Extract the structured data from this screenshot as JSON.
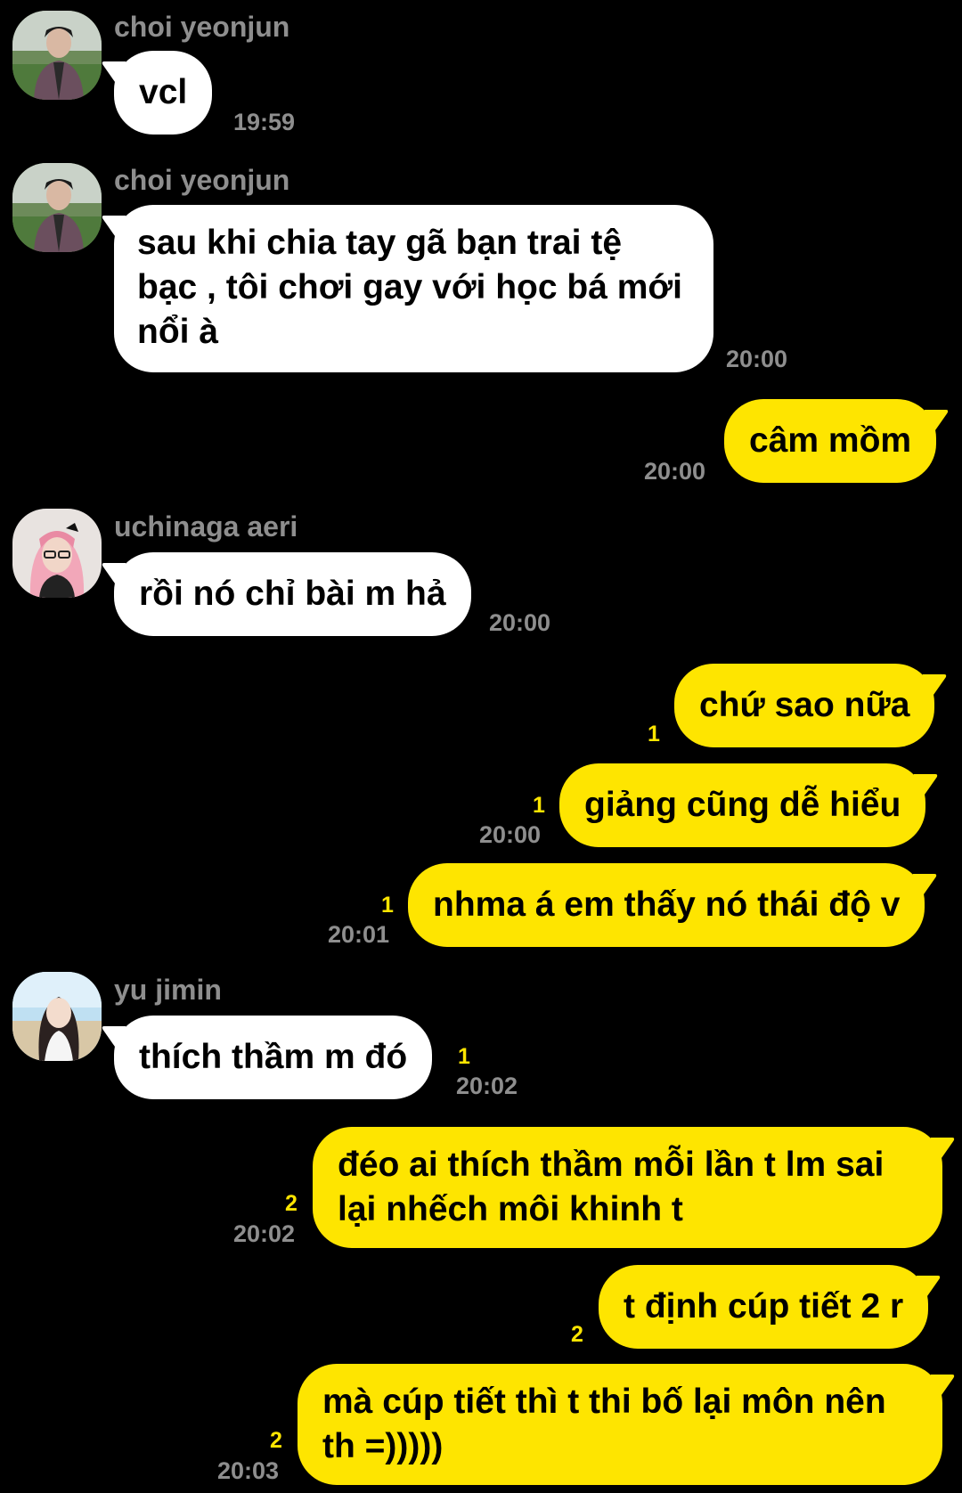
{
  "colors": {
    "background": "#000000",
    "incoming_bubble": "#ffffff",
    "outgoing_bubble": "#fee500",
    "unread_count": "#fee500",
    "meta_text": "#8e8e8e"
  },
  "messages": [
    {
      "type": "incoming",
      "sender": "choi yeonjun",
      "avatar": "avatar-choi-yeonjun",
      "text": "vcl",
      "time": "19:59"
    },
    {
      "type": "incoming",
      "sender": "choi yeonjun",
      "avatar": "avatar-choi-yeonjun",
      "text_lines": [
        "sau khi chia tay gã bạn trai tệ",
        "bạc , tôi chơi gay với học bá mới",
        "nổi à"
      ],
      "time": "20:00"
    },
    {
      "type": "outgoing",
      "text": "câm mồm",
      "time": "20:00"
    },
    {
      "type": "incoming",
      "sender": "uchinaga aeri",
      "avatar": "avatar-uchinaga-aeri",
      "text": "rồi nó chỉ bài m hả",
      "time": "20:00"
    },
    {
      "type": "outgoing",
      "text": "chứ sao nữa",
      "unread": "1"
    },
    {
      "type": "outgoing",
      "text": "giảng cũng dễ hiểu",
      "unread": "1",
      "time": "20:00"
    },
    {
      "type": "outgoing",
      "text": "nhma á em thấy nó thái độ v",
      "unread": "1",
      "time": "20:01"
    },
    {
      "type": "incoming",
      "sender": "yu jimin",
      "avatar": "avatar-yu-jimin",
      "text": "thích thầm m đó",
      "unread": "1",
      "time": "20:02"
    },
    {
      "type": "outgoing",
      "text_lines": [
        "đéo ai thích thầm mỗi lần t lm sai",
        "lại nhếch môi khinh t"
      ],
      "unread": "2",
      "time": "20:02"
    },
    {
      "type": "outgoing",
      "text": "t định cúp tiết 2 r",
      "unread": "2"
    },
    {
      "type": "outgoing",
      "text_lines": [
        "mà cúp tiết thì t thi bố lại môn nên",
        "th =)))))"
      ],
      "unread": "2",
      "time": "20:03"
    }
  ]
}
